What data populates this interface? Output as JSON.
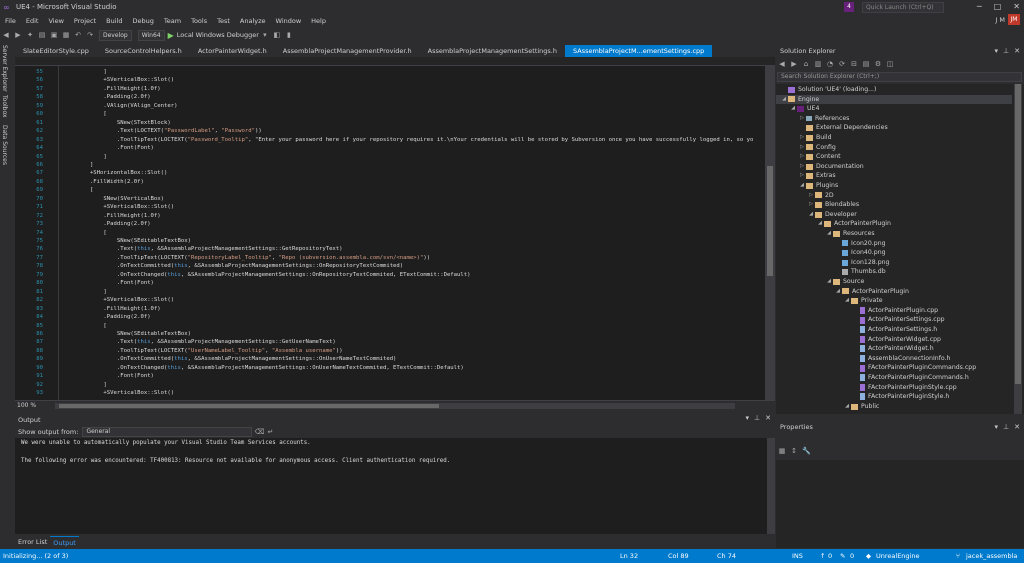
{
  "window": {
    "title": "UE4 - Microsoft Visual Studio",
    "notification_count": "4",
    "quick_launch_placeholder": "Quick Launch (Ctrl+Q)"
  },
  "menu": [
    "File",
    "Edit",
    "View",
    "Project",
    "Build",
    "Debug",
    "Team",
    "Tools",
    "Test",
    "Analyze",
    "Window",
    "Help"
  ],
  "user": {
    "name": "J M",
    "initials": "JM"
  },
  "toolbar": {
    "config": "Develop",
    "platform": "Win64",
    "debugger": "Local Windows Debugger"
  },
  "left_strip": [
    "Server Explorer",
    "Toolbox",
    "Data Sources"
  ],
  "tabs": [
    {
      "label": "SlateEditorStyle.cpp",
      "active": false
    },
    {
      "label": "SourceControlHelpers.h",
      "active": false
    },
    {
      "label": "ActorPainterWidget.h",
      "active": false
    },
    {
      "label": "AssemblaProjectManagementProvider.h",
      "active": false
    },
    {
      "label": "AssemblaProjectManagementSettings.h",
      "active": false
    },
    {
      "label": "SAssemblaProjectM...ementSettings.cpp",
      "active": true
    }
  ],
  "editor": {
    "zoom": "100 %",
    "lines": [
      {
        "n": "55",
        "t": "            ]"
      },
      {
        "n": "56",
        "t": "            +SVerticalBox::Slot()"
      },
      {
        "n": "57",
        "t": "            .FillHeight(1.0f)"
      },
      {
        "n": "58",
        "t": "            .Padding(2.0f)"
      },
      {
        "n": "59",
        "t": "            .VAlign(VAlign_Center)"
      },
      {
        "n": "60",
        "t": "            ["
      },
      {
        "n": "61",
        "t": "                SNew(STextBlock)"
      },
      {
        "n": "62",
        "t": "                .Text(LOCTEXT(\"PasswordLabel\", \"Password\"))"
      },
      {
        "n": "63",
        "t": "                .ToolTipText(LOCTEXT(\"Password_Tooltip\", \"Enter your password here if your repository requires it.\\nYour credentials will be stored by Subversion once you have successfully logged in, so yo"
      },
      {
        "n": "64",
        "t": "                .Font(Font)"
      },
      {
        "n": "65",
        "t": "            ]"
      },
      {
        "n": "66",
        "t": "        ]"
      },
      {
        "n": "67",
        "t": "        +SHorizontalBox::Slot()"
      },
      {
        "n": "68",
        "t": "        .FillWidth(2.0f)"
      },
      {
        "n": "69",
        "t": "        ["
      },
      {
        "n": "70",
        "t": "            SNew(SVerticalBox)"
      },
      {
        "n": "71",
        "t": "            +SVerticalBox::Slot()"
      },
      {
        "n": "72",
        "t": "            .FillHeight(1.0f)"
      },
      {
        "n": "73",
        "t": "            .Padding(2.0f)"
      },
      {
        "n": "74",
        "t": "            ["
      },
      {
        "n": "75",
        "t": "                SNew(SEditableTextBox)"
      },
      {
        "n": "76",
        "t": "                .Text(this, &SAssemblaProjectManagementSettings::GetRepositoryText)"
      },
      {
        "n": "77",
        "t": "                .ToolTipText(LOCTEXT(\"RepositoryLabel_Tooltip\", \"Repo (subversion.assembla.com/svn/<name>)\"))"
      },
      {
        "n": "78",
        "t": "                .OnTextCommitted(this, &SAssemblaProjectManagementSettings::OnRepositoryTextCommited)"
      },
      {
        "n": "79",
        "t": "                .OnTextChanged(this, &SAssemblaProjectManagementSettings::OnRepositoryTextCommited, ETextCommit::Default)"
      },
      {
        "n": "80",
        "t": "                .Font(Font)"
      },
      {
        "n": "81",
        "t": "            ]"
      },
      {
        "n": "82",
        "t": "            +SVerticalBox::Slot()"
      },
      {
        "n": "83",
        "t": "            .FillHeight(1.0f)"
      },
      {
        "n": "84",
        "t": "            .Padding(2.0f)"
      },
      {
        "n": "85",
        "t": "            ["
      },
      {
        "n": "86",
        "t": "                SNew(SEditableTextBox)"
      },
      {
        "n": "87",
        "t": "                .Text(this, &SAssemblaProjectManagementSettings::GetUserNameText)"
      },
      {
        "n": "88",
        "t": "                .ToolTipText(LOCTEXT(\"UserNameLabel_Tooltip\", \"Assembla username\"))"
      },
      {
        "n": "89",
        "t": "                .OnTextCommitted(this, &SAssemblaProjectManagementSettings::OnUserNameTextCommited)"
      },
      {
        "n": "90",
        "t": "                .OnTextChanged(this, &SAssemblaProjectManagementSettings::OnUserNameTextCommited, ETextCommit::Default)"
      },
      {
        "n": "91",
        "t": "                .Font(Font)"
      },
      {
        "n": "92",
        "t": "            ]"
      },
      {
        "n": "93",
        "t": "            +SVerticalBox::Slot()"
      }
    ]
  },
  "output": {
    "title": "Output",
    "show_from_label": "Show output from:",
    "source": "General",
    "lines": [
      "We were unable to automatically populate your Visual Studio Team Services accounts.",
      "",
      "The following error was encountered: TF400813: Resource not available for anonymous access. Client authentication required."
    ]
  },
  "bottom_tabs": [
    {
      "label": "Error List",
      "active": false
    },
    {
      "label": "Output",
      "active": true
    }
  ],
  "status": {
    "left": "Initializing... (2 of 3)",
    "ln": "Ln 32",
    "col": "Col 89",
    "ch": "Ch 74",
    "mode": "INS",
    "up": "0",
    "pending": "0",
    "repo": "UnrealEngine",
    "branch": "jacek_assembla"
  },
  "solution_explorer": {
    "title": "Solution Explorer",
    "search_placeholder": "Search Solution Explorer (Ctrl+;)",
    "nodes": [
      {
        "label": "Solution 'UE4' (loading...)",
        "depth": 0,
        "arrow": "",
        "icon": "sln"
      },
      {
        "label": "Engine",
        "depth": 0,
        "arrow": "◢",
        "icon": "folder",
        "selected": true
      },
      {
        "label": "UE4",
        "depth": 1,
        "arrow": "◢",
        "icon": "proj"
      },
      {
        "label": "References",
        "depth": 2,
        "arrow": "▷",
        "icon": "ref"
      },
      {
        "label": "External Dependencies",
        "depth": 2,
        "arrow": "",
        "icon": "folder"
      },
      {
        "label": "Build",
        "depth": 2,
        "arrow": "▷",
        "icon": "folder"
      },
      {
        "label": "Config",
        "depth": 2,
        "arrow": "▷",
        "icon": "folder"
      },
      {
        "label": "Content",
        "depth": 2,
        "arrow": "▷",
        "icon": "folder"
      },
      {
        "label": "Documentation",
        "depth": 2,
        "arrow": "▷",
        "icon": "folder"
      },
      {
        "label": "Extras",
        "depth": 2,
        "arrow": "▷",
        "icon": "folder"
      },
      {
        "label": "Plugins",
        "depth": 2,
        "arrow": "◢",
        "icon": "folder"
      },
      {
        "label": "2D",
        "depth": 3,
        "arrow": "▷",
        "icon": "folder"
      },
      {
        "label": "Blendables",
        "depth": 3,
        "arrow": "▷",
        "icon": "folder"
      },
      {
        "label": "Developer",
        "depth": 3,
        "arrow": "◢",
        "icon": "folder"
      },
      {
        "label": "ActorPainterPlugin",
        "depth": 4,
        "arrow": "◢",
        "icon": "folder"
      },
      {
        "label": "Resources",
        "depth": 5,
        "arrow": "◢",
        "icon": "folder"
      },
      {
        "label": "Icon20.png",
        "depth": 6,
        "arrow": "",
        "icon": "img"
      },
      {
        "label": "Icon40.png",
        "depth": 6,
        "arrow": "",
        "icon": "img"
      },
      {
        "label": "Icon128.png",
        "depth": 6,
        "arrow": "",
        "icon": "img"
      },
      {
        "label": "Thumbs.db",
        "depth": 6,
        "arrow": "",
        "icon": "db"
      },
      {
        "label": "Source",
        "depth": 5,
        "arrow": "◢",
        "icon": "folder"
      },
      {
        "label": "ActorPainterPlugin",
        "depth": 6,
        "arrow": "◢",
        "icon": "folder"
      },
      {
        "label": "Private",
        "depth": 7,
        "arrow": "◢",
        "icon": "folder"
      },
      {
        "label": "ActorPainterPlugin.cpp",
        "depth": 8,
        "arrow": "",
        "icon": "cpp"
      },
      {
        "label": "ActorPainterSettings.cpp",
        "depth": 8,
        "arrow": "",
        "icon": "cpp"
      },
      {
        "label": "ActorPainterSettings.h",
        "depth": 8,
        "arrow": "",
        "icon": "hdr"
      },
      {
        "label": "ActorPainterWidget.cpp",
        "depth": 8,
        "arrow": "",
        "icon": "cpp"
      },
      {
        "label": "ActorPainterWidget.h",
        "depth": 8,
        "arrow": "",
        "icon": "hdr"
      },
      {
        "label": "AssemblaConnectionInfo.h",
        "depth": 8,
        "arrow": "",
        "icon": "hdr"
      },
      {
        "label": "FActorPainterPluginCommands.cpp",
        "depth": 8,
        "arrow": "",
        "icon": "cpp"
      },
      {
        "label": "FActorPainterPluginCommands.h",
        "depth": 8,
        "arrow": "",
        "icon": "hdr"
      },
      {
        "label": "FActorPainterPluginStyle.cpp",
        "depth": 8,
        "arrow": "",
        "icon": "cpp"
      },
      {
        "label": "FActorPainterPluginStyle.h",
        "depth": 8,
        "arrow": "",
        "icon": "hdr"
      },
      {
        "label": "Public",
        "depth": 7,
        "arrow": "◢",
        "icon": "folder"
      }
    ]
  },
  "properties": {
    "title": "Properties"
  }
}
